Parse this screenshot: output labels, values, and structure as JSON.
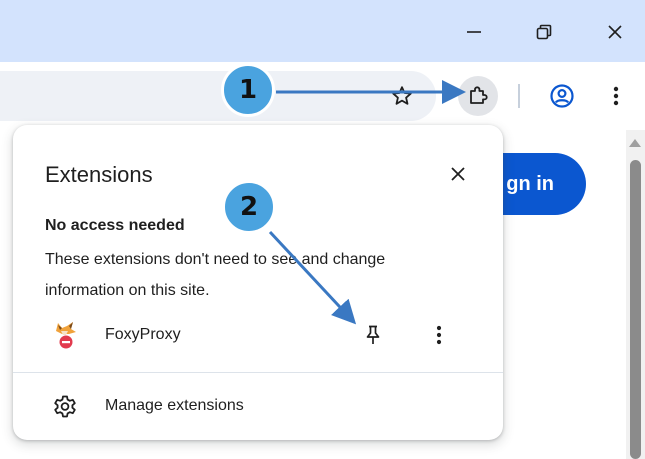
{
  "window_controls": {
    "minimize_glyph": "—",
    "restore_glyph": "❐",
    "close_glyph": "✕"
  },
  "toolbar": {
    "icons": [
      "star-icon",
      "puzzle-extensions-icon",
      "profile-icon",
      "more-vert-icon"
    ]
  },
  "page": {
    "signin_label": "gn in"
  },
  "popup": {
    "title": "Extensions",
    "close_glyph": "✕",
    "section_heading": "No access needed",
    "section_description": "These extensions don't need to see and change information on this site.",
    "extensions": [
      {
        "name": "FoxyProxy",
        "pin_icon": "pin-icon",
        "more_icon": "more-vert-icon"
      }
    ],
    "manage_label": "Manage extensions",
    "manage_icon": "gear-icon"
  },
  "annotations": {
    "step1": "1",
    "step2": "2",
    "color": "#4aa3df",
    "arrow_color": "#3a78c2"
  },
  "colors": {
    "titlebar": "#d3e3fd",
    "accent": "#0b57d0",
    "omnibox": "#eef1f6"
  }
}
